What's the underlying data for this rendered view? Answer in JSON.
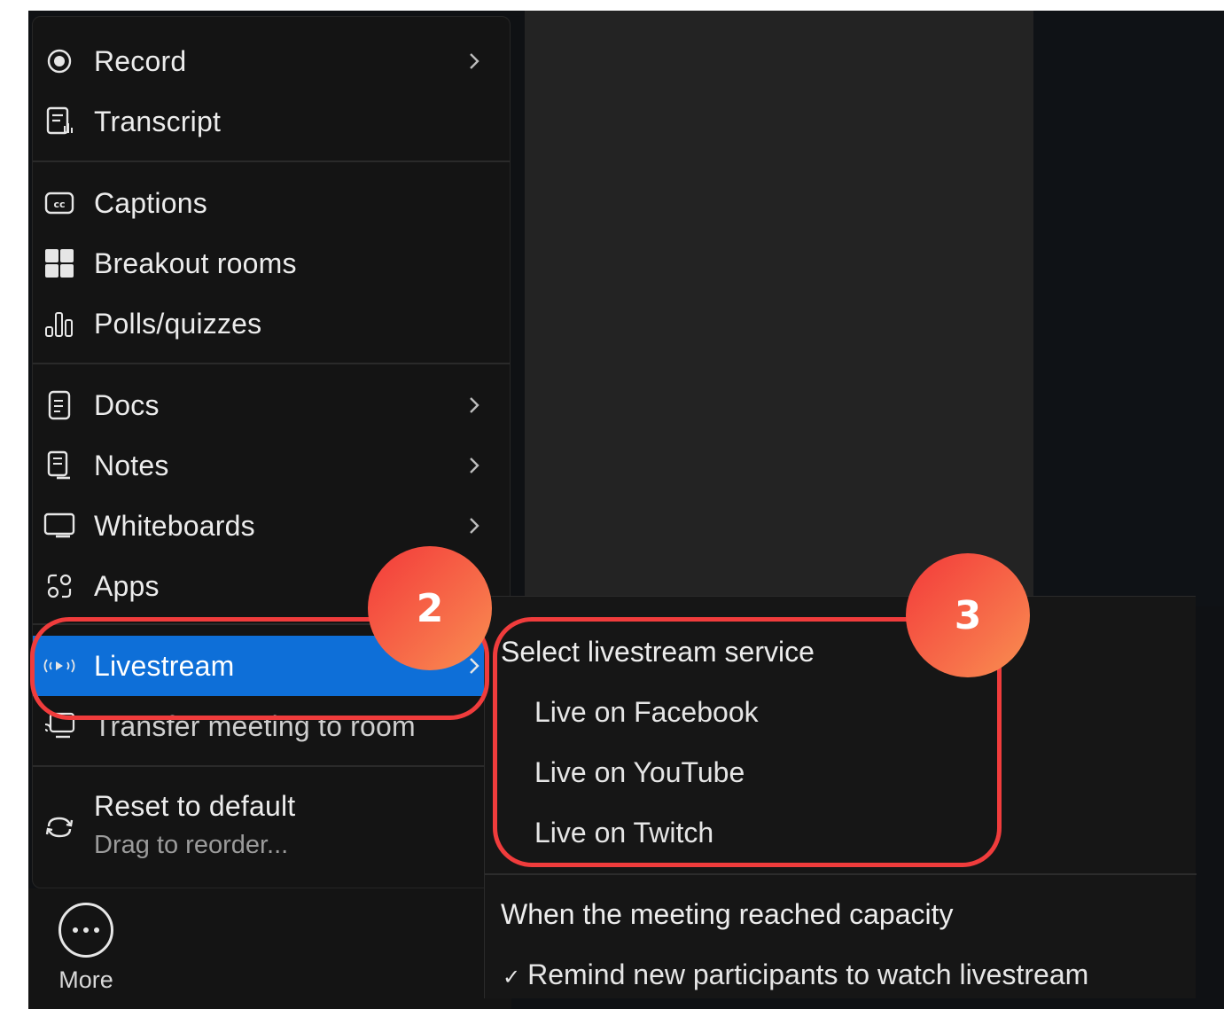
{
  "menu": {
    "items": [
      {
        "id": "record",
        "label": "Record",
        "icon": "record-icon",
        "submenu": true
      },
      {
        "id": "transcript",
        "label": "Transcript",
        "icon": "transcript-icon",
        "submenu": false
      },
      {
        "id": "captions",
        "label": "Captions",
        "icon": "captions-icon",
        "submenu": false
      },
      {
        "id": "breakout",
        "label": "Breakout rooms",
        "icon": "breakout-rooms-icon",
        "submenu": false
      },
      {
        "id": "polls",
        "label": "Polls/quizzes",
        "icon": "polls-icon",
        "submenu": false
      },
      {
        "id": "docs",
        "label": "Docs",
        "icon": "docs-icon",
        "submenu": true
      },
      {
        "id": "notes",
        "label": "Notes",
        "icon": "notes-icon",
        "submenu": true
      },
      {
        "id": "whiteboards",
        "label": "Whiteboards",
        "icon": "whiteboard-icon",
        "submenu": true
      },
      {
        "id": "apps",
        "label": "Apps",
        "icon": "apps-icon",
        "submenu": false
      },
      {
        "id": "livestream",
        "label": "Livestream",
        "icon": "livestream-icon",
        "submenu": true,
        "active": true
      },
      {
        "id": "transfer",
        "label": "Transfer meeting to room",
        "icon": "transfer-icon",
        "submenu": false
      }
    ],
    "reset": {
      "label": "Reset to default",
      "sublabel": "Drag to reorder...",
      "icon": "reset-icon"
    }
  },
  "more_button": {
    "label": "More",
    "icon": "more-icon"
  },
  "submenu": {
    "heading": "Select livestream service",
    "services": [
      "Live on Facebook",
      "Live on YouTube",
      "Live on Twitch"
    ],
    "capacity_heading": "When the meeting reached capacity",
    "capacity_option": {
      "check": "✓",
      "label": "Remind new participants to watch livestream"
    }
  },
  "annotations": {
    "step_2": "2",
    "step_3": "3",
    "highlight_color": "#f03c3c"
  },
  "colors": {
    "active_item": "#0e6fd8",
    "menu_bg": "#141414"
  }
}
